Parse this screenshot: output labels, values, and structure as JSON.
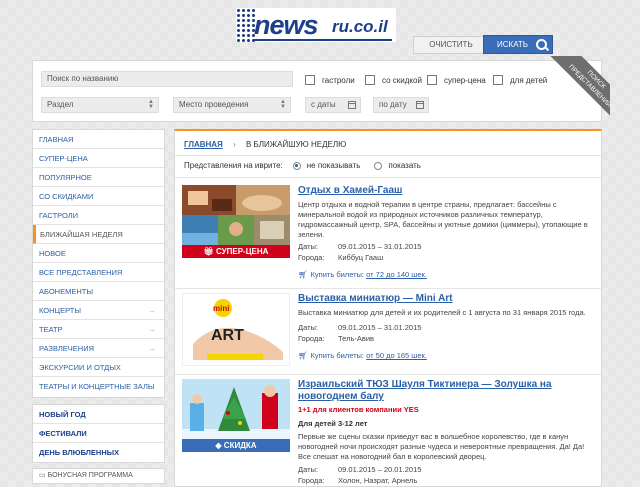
{
  "logo": {
    "word": "news",
    "domain": "ru.co.il"
  },
  "search": {
    "name_placeholder": "Поиск по названию",
    "section_label": "Раздел",
    "venue_label": "Место проведения",
    "from_date_label": "с даты",
    "to_date_label": "по дату",
    "checkboxes": [
      {
        "label": "гастроли"
      },
      {
        "label": "со скидкой"
      },
      {
        "label": "супер-цена"
      },
      {
        "label": "для детей"
      }
    ],
    "clear_label": "ОЧИСТИТЬ",
    "search_label": "ИСКАТЬ",
    "ribbon_line1": "ПОИСК",
    "ribbon_line2": "ПРЕДСТАВЛЕНИЙ"
  },
  "sidebar": {
    "items": [
      {
        "label": "ГЛАВНАЯ"
      },
      {
        "label": "СУПЕР-ЦЕНА"
      },
      {
        "label": "ПОПУЛЯРНОЕ"
      },
      {
        "label": "СО СКИДКАМИ"
      },
      {
        "label": "ГАСТРОЛИ"
      },
      {
        "label": "БЛИЖАЙШАЯ НЕДЕЛЯ"
      },
      {
        "label": "НОВОЕ"
      },
      {
        "label": "ВСЕ ПРЕДСТАВЛЕНИЯ"
      },
      {
        "label": "АБОНЕМЕНТЫ"
      },
      {
        "label": "КОНЦЕРТЫ"
      },
      {
        "label": "ТЕАТР"
      },
      {
        "label": "РАЗВЛЕЧЕНИЯ"
      },
      {
        "label": "ЭКСКУРСИИ И ОТДЫХ"
      },
      {
        "label": "ТЕАТРЫ И КОНЦЕРТНЫЕ ЗАЛЫ"
      }
    ],
    "arrow": "→",
    "special": [
      {
        "label": "НОВЫЙ ГОД"
      },
      {
        "label": "ФЕСТИВАЛИ"
      },
      {
        "label": "ДЕНЬ ВЛЮБЛЕННЫХ"
      }
    ],
    "bonus": "БОНУСНАЯ ПРОГРАММА"
  },
  "main": {
    "breadcrumb_home": "ГЛАВНАЯ",
    "breadcrumb_sep": "›",
    "breadcrumb_current": "В БЛИЖАЙШУЮ НЕДЕЛЮ",
    "hebrew_label": "Представления на иврите:",
    "hebrew_opt_hide": "не показывать",
    "hebrew_opt_show": "показать",
    "dates_label": "Даты:",
    "city_label": "Города:",
    "events": [
      {
        "title": "Отдых в Хамей-Гааш",
        "description": "Центр отдыха и водной терапии в центре страны, предлагает: бассейны с минеральной водой из природных источников различных температур, гидромассажный центр, SPA, бассейны и уютные домики (циммеры), утопающие в зелени.",
        "dates": "09.01.2015 – 31.01.2015",
        "city": "Киббуц Гааш",
        "tickets": "Купить билеты:",
        "price": "от 72 до 140 шек.",
        "badge": "СУПЕР-ЦЕНА",
        "badge_color": "#d0021b"
      },
      {
        "title": "Выставка миниатюр — Mini Art",
        "description": "Выставка миниатюр для детей и их родителей с 1 августа по 31 января 2015 года.",
        "dates": "09.01.2015 – 31.01.2015",
        "city": "Тель-Авив",
        "tickets": "Купить билеты:",
        "price": "от 50 до 165 шек.",
        "logo_top": "mini",
        "logo_bottom": "ART"
      },
      {
        "title": "Израильский ТЮЗ Шауля Тиктинера — Золушка на новогоднем балу",
        "promo": "1+1 для клиентов компании YES",
        "age": "Для детей 3-12 лет",
        "description": "Первые же сцены сказки приведут вас в волшебное королевство, где в канун новогодней ночи происходят разные чудеса и невероятные превращения. Да! Да! Все спешат на новогодний бал в королевский дворец.",
        "dates": "09.01.2015 – 20.01.2015",
        "city": "Холон, Назрат, Арнель",
        "badge": "СКИДКА",
        "badge_color": "#3a6db7"
      }
    ]
  }
}
